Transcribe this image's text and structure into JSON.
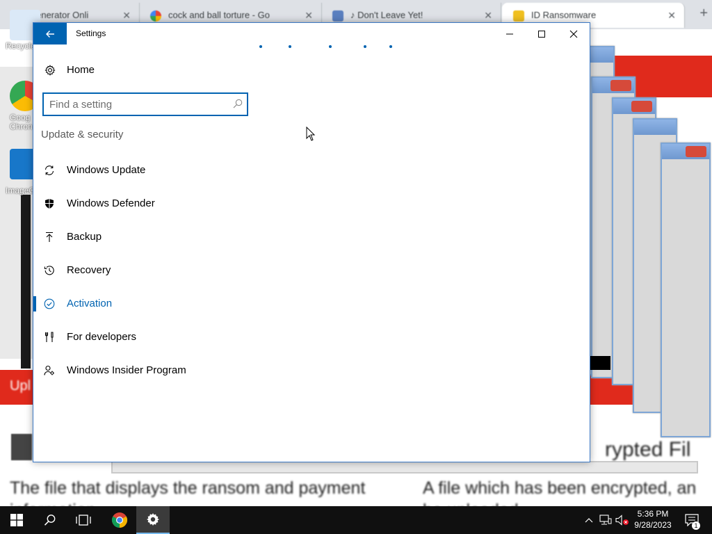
{
  "background": {
    "browser_tabs": [
      {
        "label": "Generator Onli",
        "icon": "generator-favicon"
      },
      {
        "label": "cock and ball torture - Go",
        "icon": "google-favicon"
      },
      {
        "label": "♪ Don't Leave Yet!",
        "icon": "page-favicon"
      },
      {
        "label": "ID Ransomware",
        "icon": "lock-favicon"
      }
    ],
    "desktop_icons": [
      {
        "label": "Recycle",
        "icon": "recycle-bin-icon"
      },
      {
        "label": "Goog Chron",
        "icon": "chrome-desktop-icon"
      },
      {
        "label": "ImageG",
        "icon": "imageglass-icon"
      }
    ],
    "banner_left_text": "Upl",
    "page_heading_right": "rypted Fil",
    "page_text_left": "The file that displays the ransom and payment",
    "page_text_left_2": "information",
    "page_text_right": "A file which has been encrypted, an",
    "page_text_right_2": "be uploaded"
  },
  "window": {
    "title": "Settings",
    "back_icon": "back-arrow-icon",
    "minimize_icon": "minimize-icon",
    "maximize_icon": "maximize-icon",
    "close_icon": "close-icon"
  },
  "sidebar": {
    "home_label": "Home",
    "home_icon": "gear-icon",
    "search": {
      "placeholder": "Find a setting",
      "value": "",
      "icon": "search-icon"
    },
    "section_heading": "Update & security",
    "items": [
      {
        "label": "Windows Update",
        "icon": "sync-icon",
        "selected": false
      },
      {
        "label": "Windows Defender",
        "icon": "shield-icon",
        "selected": false
      },
      {
        "label": "Backup",
        "icon": "upload-arrow-icon",
        "selected": false
      },
      {
        "label": "Recovery",
        "icon": "history-icon",
        "selected": false
      },
      {
        "label": "Activation",
        "icon": "check-circle-icon",
        "selected": true
      },
      {
        "label": "For developers",
        "icon": "developer-tools-icon",
        "selected": false
      },
      {
        "label": "Windows Insider Program",
        "icon": "insider-person-icon",
        "selected": false
      }
    ]
  },
  "taskbar": {
    "start_icon": "windows-logo-icon",
    "search_icon": "search-icon",
    "task_view_icon": "task-view-icon",
    "apps": [
      {
        "name": "Google Chrome",
        "icon": "chrome-icon",
        "active": false
      },
      {
        "name": "Settings",
        "icon": "gear-icon",
        "active": true
      }
    ],
    "tray": {
      "chevron_icon": "chevron-up-icon",
      "network_icon": "network-icon",
      "volume_icon": "volume-muted-icon",
      "time": "5:36 PM",
      "date": "9/28/2023",
      "notification_icon": "action-center-icon",
      "notification_count": "1"
    }
  },
  "colors": {
    "accent": "#0063b1",
    "taskbar": "#101010",
    "banner_red": "#e02a1c"
  }
}
